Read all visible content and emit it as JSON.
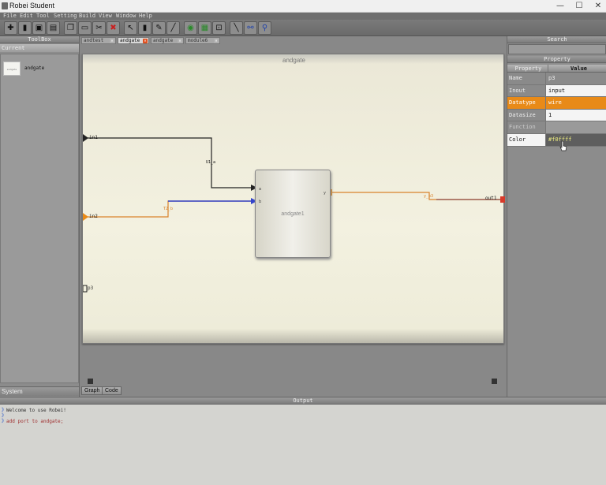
{
  "window": {
    "title": "Robei Student",
    "minimize": "—",
    "maximize": "☐",
    "close": "✕"
  },
  "menu": [
    "File",
    "Edit",
    "Tool",
    "Setting",
    "Build",
    "View",
    "Window",
    "Help"
  ],
  "toolbar": {
    "icons": [
      "new-icon",
      "open-icon",
      "save-icon",
      "save-as-icon",
      "copy-icon",
      "paste-icon",
      "cut-icon",
      "delete-icon",
      "select-icon",
      "port-icon",
      "wire-icon",
      "pen-icon",
      "simulate-icon",
      "run-icon",
      "zoom-icon",
      "brush-icon",
      "connect-icon",
      "export-icon"
    ]
  },
  "left_panel": {
    "header": "ToolBox",
    "current_tab": "Current",
    "items": [
      {
        "thumb": "endgate",
        "label": "andgate"
      }
    ],
    "system_tab": "System"
  },
  "doc_tabs": [
    {
      "label": "andtest",
      "active": false
    },
    {
      "label": "andgate",
      "active": true
    },
    {
      "label": "andgate",
      "active": false
    },
    {
      "label": "module6",
      "active": false
    }
  ],
  "canvas": {
    "title": "andgate",
    "block_name": "andgate1",
    "ports": {
      "in1": "in1",
      "in2": "in2",
      "out1": "out1",
      "p3": "p3",
      "a": "a",
      "b": "b",
      "y": "y"
    },
    "wire_labels": {
      "w1": "U1_a",
      "w2": "T2_b",
      "w3": "y_p3"
    }
  },
  "bottom_tabs": [
    "Graph",
    "Code"
  ],
  "right_panel": {
    "search_header": "Search",
    "property_header": "Property",
    "columns": [
      "Property",
      "Value"
    ],
    "rows": [
      {
        "k": "Name",
        "v": "p3"
      },
      {
        "k": "Inout",
        "v": "input"
      },
      {
        "k": "Datatype",
        "v": "wire"
      },
      {
        "k": "Datasize",
        "v": "1"
      },
      {
        "k": "Function",
        "v": ""
      },
      {
        "k": "Color",
        "v": "#f0ffff"
      }
    ]
  },
  "output": {
    "header": "Output",
    "lines": [
      {
        "prefix": "》",
        "text": "Welcome to use Robei!"
      },
      {
        "prefix": "》",
        "text": ""
      },
      {
        "prefix": "》",
        "text": "add port to andgate;"
      }
    ]
  },
  "colors": {
    "accent": "#e88a18",
    "blue_wire": "#3344cc",
    "orange_wire": "#d9822b",
    "red_port": "#d83a2a"
  }
}
